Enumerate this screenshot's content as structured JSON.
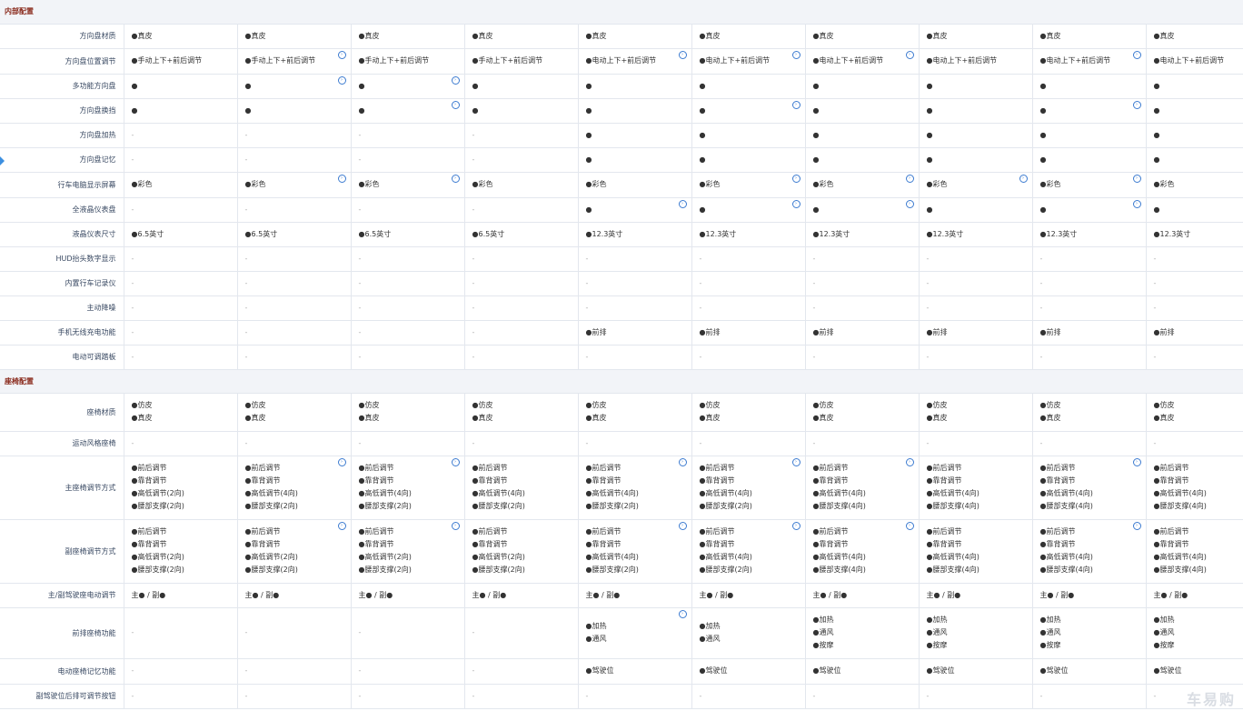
{
  "sections": [
    {
      "title": "内部配置",
      "rows": [
        {
          "label": "方向盘材质",
          "h": 27,
          "cells": [
            [
              "●真皮"
            ],
            [
              "●真皮"
            ],
            [
              "●真皮"
            ],
            [
              "●真皮"
            ],
            [
              "●真皮"
            ],
            [
              "●真皮"
            ],
            [
              "●真皮"
            ],
            [
              "●真皮"
            ],
            [
              "●真皮"
            ],
            [
              "●真皮"
            ]
          ],
          "info": []
        },
        {
          "label": "方向盘位置调节",
          "h": 28,
          "cells": [
            [
              "●手动上下+前后调节"
            ],
            [
              "●手动上下+前后调节"
            ],
            [
              "●手动上下+前后调节"
            ],
            [
              "●手动上下+前后调节"
            ],
            [
              "●电动上下+前后调节"
            ],
            [
              "●电动上下+前后调节"
            ],
            [
              "●电动上下+前后调节"
            ],
            [
              "●电动上下+前后调节"
            ],
            [
              "●电动上下+前后调节"
            ],
            [
              "●电动上下+前后调节"
            ]
          ],
          "info": [
            1,
            4,
            5,
            6,
            8
          ]
        },
        {
          "label": "多功能方向盘",
          "h": 27,
          "cells": [
            [
              "●"
            ],
            [
              "●"
            ],
            [
              "●"
            ],
            [
              "●"
            ],
            [
              "●"
            ],
            [
              "●"
            ],
            [
              "●"
            ],
            [
              "●"
            ],
            [
              "●"
            ],
            [
              "●"
            ]
          ],
          "info": [
            1,
            2
          ]
        },
        {
          "label": "方向盘换挡",
          "h": 27,
          "cells": [
            [
              "●"
            ],
            [
              "●"
            ],
            [
              "●"
            ],
            [
              "●"
            ],
            [
              "●"
            ],
            [
              "●"
            ],
            [
              "●"
            ],
            [
              "●"
            ],
            [
              "●"
            ],
            [
              "●"
            ]
          ],
          "info": [
            2,
            5,
            8
          ]
        },
        {
          "label": "方向盘加热",
          "h": 27,
          "cells": [
            [
              "-"
            ],
            [
              "-"
            ],
            [
              "-"
            ],
            [
              "-"
            ],
            [
              "●"
            ],
            [
              "●"
            ],
            [
              "●"
            ],
            [
              "●"
            ],
            [
              "●"
            ],
            [
              "●"
            ]
          ],
          "info": []
        },
        {
          "label": "方向盘记忆",
          "h": 27,
          "cells": [
            [
              "-"
            ],
            [
              "-"
            ],
            [
              "-"
            ],
            [
              "-"
            ],
            [
              "●"
            ],
            [
              "●"
            ],
            [
              "●"
            ],
            [
              "●"
            ],
            [
              "●"
            ],
            [
              "●"
            ]
          ],
          "info": []
        },
        {
          "label": "行车电脑显示屏幕",
          "h": 28,
          "cells": [
            [
              "●彩色"
            ],
            [
              "●彩色"
            ],
            [
              "●彩色"
            ],
            [
              "●彩色"
            ],
            [
              "●彩色"
            ],
            [
              "●彩色"
            ],
            [
              "●彩色"
            ],
            [
              "●彩色"
            ],
            [
              "●彩色"
            ],
            [
              "●彩色"
            ]
          ],
          "info": [
            1,
            2,
            5,
            6,
            7,
            8
          ]
        },
        {
          "label": "全液晶仪表盘",
          "h": 27,
          "cells": [
            [
              "-"
            ],
            [
              "-"
            ],
            [
              "-"
            ],
            [
              "-"
            ],
            [
              "●"
            ],
            [
              "●"
            ],
            [
              "●"
            ],
            [
              "●"
            ],
            [
              "●"
            ],
            [
              "●"
            ]
          ],
          "info": [
            4,
            5,
            6,
            8
          ]
        },
        {
          "label": "液晶仪表尺寸",
          "h": 27,
          "cells": [
            [
              "●6.5英寸"
            ],
            [
              "●6.5英寸"
            ],
            [
              "●6.5英寸"
            ],
            [
              "●6.5英寸"
            ],
            [
              "●12.3英寸"
            ],
            [
              "●12.3英寸"
            ],
            [
              "●12.3英寸"
            ],
            [
              "●12.3英寸"
            ],
            [
              "●12.3英寸"
            ],
            [
              "●12.3英寸"
            ]
          ],
          "info": []
        },
        {
          "label": "HUD抬头数字显示",
          "h": 27,
          "cells": [
            [
              "-"
            ],
            [
              "-"
            ],
            [
              "-"
            ],
            [
              "-"
            ],
            [
              "-"
            ],
            [
              "-"
            ],
            [
              "-"
            ],
            [
              "-"
            ],
            [
              "-"
            ],
            [
              "-"
            ]
          ],
          "info": []
        },
        {
          "label": "内置行车记录仪",
          "h": 27,
          "cells": [
            [
              "-"
            ],
            [
              "-"
            ],
            [
              "-"
            ],
            [
              "-"
            ],
            [
              "-"
            ],
            [
              "-"
            ],
            [
              "-"
            ],
            [
              "-"
            ],
            [
              "-"
            ],
            [
              "-"
            ]
          ],
          "info": []
        },
        {
          "label": "主动降噪",
          "h": 27,
          "cells": [
            [
              "-"
            ],
            [
              "-"
            ],
            [
              "-"
            ],
            [
              "-"
            ],
            [
              "-"
            ],
            [
              "-"
            ],
            [
              "-"
            ],
            [
              "-"
            ],
            [
              "-"
            ],
            [
              "-"
            ]
          ],
          "info": []
        },
        {
          "label": "手机无线充电功能",
          "h": 27,
          "cells": [
            [
              "-"
            ],
            [
              "-"
            ],
            [
              "-"
            ],
            [
              "-"
            ],
            [
              "●前排"
            ],
            [
              "●前排"
            ],
            [
              "●前排"
            ],
            [
              "●前排"
            ],
            [
              "●前排"
            ],
            [
              "●前排"
            ]
          ],
          "info": []
        },
        {
          "label": "电动可调踏板",
          "h": 27,
          "cells": [
            [
              "-"
            ],
            [
              "-"
            ],
            [
              "-"
            ],
            [
              "-"
            ],
            [
              "-"
            ],
            [
              "-"
            ],
            [
              "-"
            ],
            [
              "-"
            ],
            [
              "-"
            ],
            [
              "-"
            ]
          ],
          "info": []
        }
      ]
    },
    {
      "title": "座椅配置",
      "rows": [
        {
          "label": "座椅材质",
          "h": 42,
          "cells": [
            [
              "●仿皮",
              "●真皮"
            ],
            [
              "●仿皮",
              "●真皮"
            ],
            [
              "●仿皮",
              "●真皮"
            ],
            [
              "●仿皮",
              "●真皮"
            ],
            [
              "●仿皮",
              "●真皮"
            ],
            [
              "●仿皮",
              "●真皮"
            ],
            [
              "●仿皮",
              "●真皮"
            ],
            [
              "●仿皮",
              "●真皮"
            ],
            [
              "●仿皮",
              "●真皮"
            ],
            [
              "●仿皮",
              "●真皮"
            ]
          ],
          "info": []
        },
        {
          "label": "运动风格座椅",
          "h": 27,
          "cells": [
            [
              "-"
            ],
            [
              "-"
            ],
            [
              "-"
            ],
            [
              "-"
            ],
            [
              "-"
            ],
            [
              "-"
            ],
            [
              "-"
            ],
            [
              "-"
            ],
            [
              "-"
            ],
            [
              "-"
            ]
          ],
          "info": []
        },
        {
          "label": "主座椅调节方式",
          "h": 70,
          "cells": [
            [
              "●前后调节",
              "●靠背调节",
              "●高低调节(2向)",
              "●腰部支撑(2向)"
            ],
            [
              "●前后调节",
              "●靠背调节",
              "●高低调节(4向)",
              "●腰部支撑(2向)"
            ],
            [
              "●前后调节",
              "●靠背调节",
              "●高低调节(4向)",
              "●腰部支撑(2向)"
            ],
            [
              "●前后调节",
              "●靠背调节",
              "●高低调节(4向)",
              "●腰部支撑(2向)"
            ],
            [
              "●前后调节",
              "●靠背调节",
              "●高低调节(4向)",
              "●腰部支撑(2向)"
            ],
            [
              "●前后调节",
              "●靠背调节",
              "●高低调节(4向)",
              "●腰部支撑(2向)"
            ],
            [
              "●前后调节",
              "●靠背调节",
              "●高低调节(4向)",
              "●腰部支撑(4向)"
            ],
            [
              "●前后调节",
              "●靠背调节",
              "●高低调节(4向)",
              "●腰部支撑(4向)"
            ],
            [
              "●前后调节",
              "●靠背调节",
              "●高低调节(4向)",
              "●腰部支撑(4向)"
            ],
            [
              "●前后调节",
              "●靠背调节",
              "●高低调节(4向)",
              "●腰部支撑(4向)"
            ]
          ],
          "info": [
            1,
            2,
            4,
            5,
            6,
            8
          ]
        },
        {
          "label": "副座椅调节方式",
          "h": 70,
          "cells": [
            [
              "●前后调节",
              "●靠背调节",
              "●高低调节(2向)",
              "●腰部支撑(2向)"
            ],
            [
              "●前后调节",
              "●靠背调节",
              "●高低调节(2向)",
              "●腰部支撑(2向)"
            ],
            [
              "●前后调节",
              "●靠背调节",
              "●高低调节(2向)",
              "●腰部支撑(2向)"
            ],
            [
              "●前后调节",
              "●靠背调节",
              "●高低调节(2向)",
              "●腰部支撑(2向)"
            ],
            [
              "●前后调节",
              "●靠背调节",
              "●高低调节(4向)",
              "●腰部支撑(2向)"
            ],
            [
              "●前后调节",
              "●靠背调节",
              "●高低调节(4向)",
              "●腰部支撑(2向)"
            ],
            [
              "●前后调节",
              "●靠背调节",
              "●高低调节(4向)",
              "●腰部支撑(4向)"
            ],
            [
              "●前后调节",
              "●靠背调节",
              "●高低调节(4向)",
              "●腰部支撑(4向)"
            ],
            [
              "●前后调节",
              "●靠背调节",
              "●高低调节(4向)",
              "●腰部支撑(4向)"
            ],
            [
              "●前后调节",
              "●靠背调节",
              "●高低调节(4向)",
              "●腰部支撑(4向)"
            ]
          ],
          "info": [
            1,
            2,
            4,
            5,
            6,
            8
          ]
        },
        {
          "label": "主/副驾驶座电动调节",
          "h": 27,
          "cells": [
            [
              "主● / 副●"
            ],
            [
              "主● / 副●"
            ],
            [
              "主● / 副●"
            ],
            [
              "主● / 副●"
            ],
            [
              "主● / 副●"
            ],
            [
              "主● / 副●"
            ],
            [
              "主● / 副●"
            ],
            [
              "主● / 副●"
            ],
            [
              "主● / 副●"
            ],
            [
              "主● / 副●"
            ]
          ],
          "info": []
        },
        {
          "label": "前排座椅功能",
          "h": 56,
          "cells": [
            [
              "-"
            ],
            [
              "-"
            ],
            [
              "-"
            ],
            [
              "-"
            ],
            [
              "●加热",
              "●通风"
            ],
            [
              "●加热",
              "●通风"
            ],
            [
              "●加热",
              "●通风",
              "●按摩"
            ],
            [
              "●加热",
              "●通风",
              "●按摩"
            ],
            [
              "●加热",
              "●通风",
              "●按摩"
            ],
            [
              "●加热",
              "●通风",
              "●按摩"
            ]
          ],
          "info": [
            4
          ]
        },
        {
          "label": "电动座椅记忆功能",
          "h": 28,
          "cells": [
            [
              "-"
            ],
            [
              "-"
            ],
            [
              "-"
            ],
            [
              "-"
            ],
            [
              "●驾驶位"
            ],
            [
              "●驾驶位"
            ],
            [
              "●驾驶位"
            ],
            [
              "●驾驶位"
            ],
            [
              "●驾驶位"
            ],
            [
              "●驾驶位"
            ]
          ],
          "info": []
        },
        {
          "label": "副驾驶位后排可调节按钮",
          "h": 27,
          "cells": [
            [
              "-"
            ],
            [
              "-"
            ],
            [
              "-"
            ],
            [
              "-"
            ],
            [
              "-"
            ],
            [
              "-"
            ],
            [
              "-"
            ],
            [
              "-"
            ],
            [
              "-"
            ],
            [
              "-"
            ]
          ],
          "info": []
        }
      ]
    }
  ],
  "watermark": "车易购",
  "info_glyph": "›"
}
